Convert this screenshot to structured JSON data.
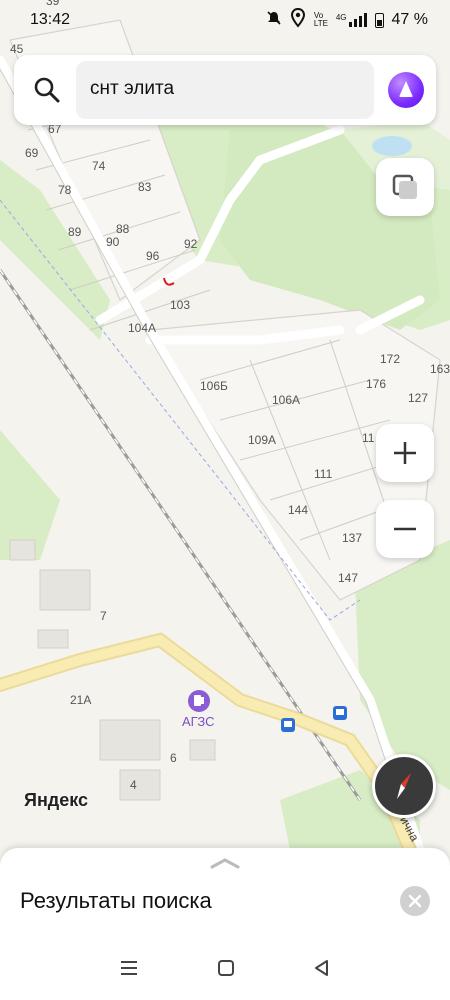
{
  "status": {
    "time": "13:42",
    "battery": "47 %",
    "volte": "Vo LTE",
    "net": "4G"
  },
  "search": {
    "query": "снт элита"
  },
  "map_labels": [
    {
      "id": "39",
      "text": "39"
    },
    {
      "id": "45",
      "text": "45"
    },
    {
      "id": "67",
      "text": "67"
    },
    {
      "id": "69",
      "text": "69"
    },
    {
      "id": "74",
      "text": "74"
    },
    {
      "id": "78",
      "text": "78"
    },
    {
      "id": "83",
      "text": "83"
    },
    {
      "id": "89",
      "text": "89"
    },
    {
      "id": "88",
      "text": "88"
    },
    {
      "id": "90",
      "text": "90"
    },
    {
      "id": "96",
      "text": "96"
    },
    {
      "id": "92",
      "text": "92"
    },
    {
      "id": "103",
      "text": "103"
    },
    {
      "id": "104a",
      "text": "104А"
    },
    {
      "id": "106b",
      "text": "106Б"
    },
    {
      "id": "106a",
      "text": "106А"
    },
    {
      "id": "109a",
      "text": "109А"
    },
    {
      "id": "172",
      "text": "172"
    },
    {
      "id": "176",
      "text": "176"
    },
    {
      "id": "163",
      "text": "163"
    },
    {
      "id": "127",
      "text": "127"
    },
    {
      "id": "11x",
      "text": "11"
    },
    {
      "id": "111",
      "text": "111"
    },
    {
      "id": "144",
      "text": "144"
    },
    {
      "id": "137",
      "text": "137"
    },
    {
      "id": "147",
      "text": "147"
    },
    {
      "id": "7",
      "text": "7"
    },
    {
      "id": "21a",
      "text": "21А"
    },
    {
      "id": "6",
      "text": "6"
    },
    {
      "id": "4",
      "text": "4"
    }
  ],
  "poi": {
    "gas_station_label": "АГЗС"
  },
  "street": {
    "label": "ична"
  },
  "logo": "Яндекс",
  "sheet": {
    "title": "Результаты поиска"
  },
  "colors": {
    "map_bg": "#f4f3ee",
    "forest": "#d8ecc6",
    "road_yellow": "#f7e9a8",
    "water": "#bfe0f2",
    "alice": "#7a2cff"
  }
}
